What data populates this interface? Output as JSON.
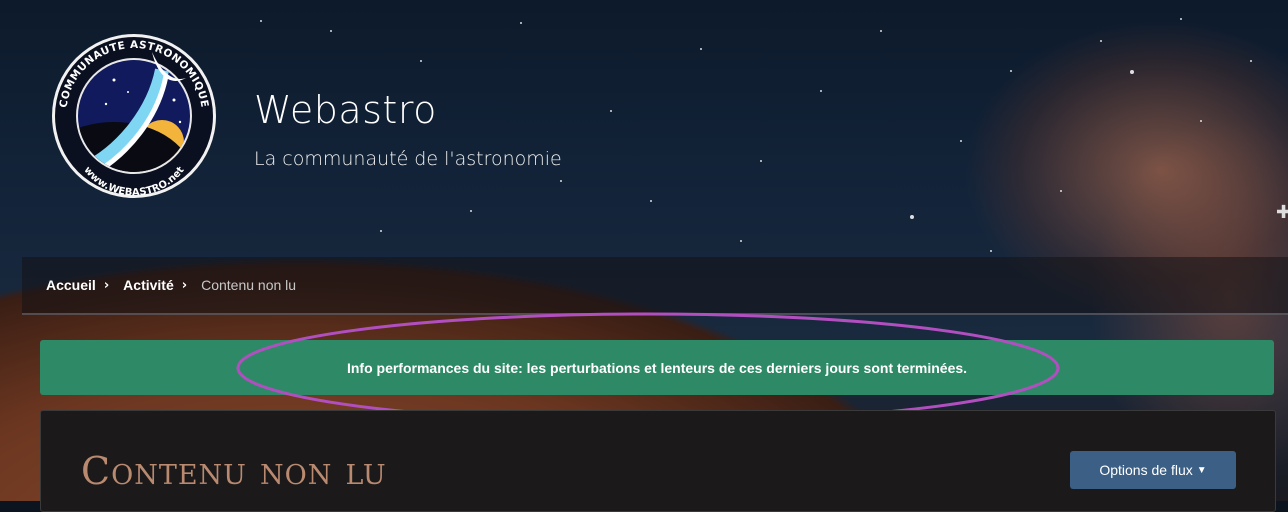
{
  "header": {
    "logo_ring_text": "COMMUNAUTE ASTRONOMIQUE",
    "logo_url_text": "www.WEBASTRO.net",
    "site_title": "Webastro",
    "tagline": "La communauté de l'astronomie"
  },
  "breadcrumb": {
    "items": [
      "Accueil",
      "Activité"
    ],
    "separator": "›",
    "current": "Contenu non lu"
  },
  "notice": {
    "text": "Info performances du site: les perturbations et lenteurs de ces derniers jours sont terminées."
  },
  "page": {
    "title": "Contenu non lu",
    "feed_button_label": "Options de flux",
    "feed_button_icon": "caret-down-icon"
  },
  "colors": {
    "notice_bg": "#2e8a66",
    "highlight_ellipse": "#b24fc0",
    "button_bg": "#3b5f85",
    "title_color": "#b98a70"
  }
}
